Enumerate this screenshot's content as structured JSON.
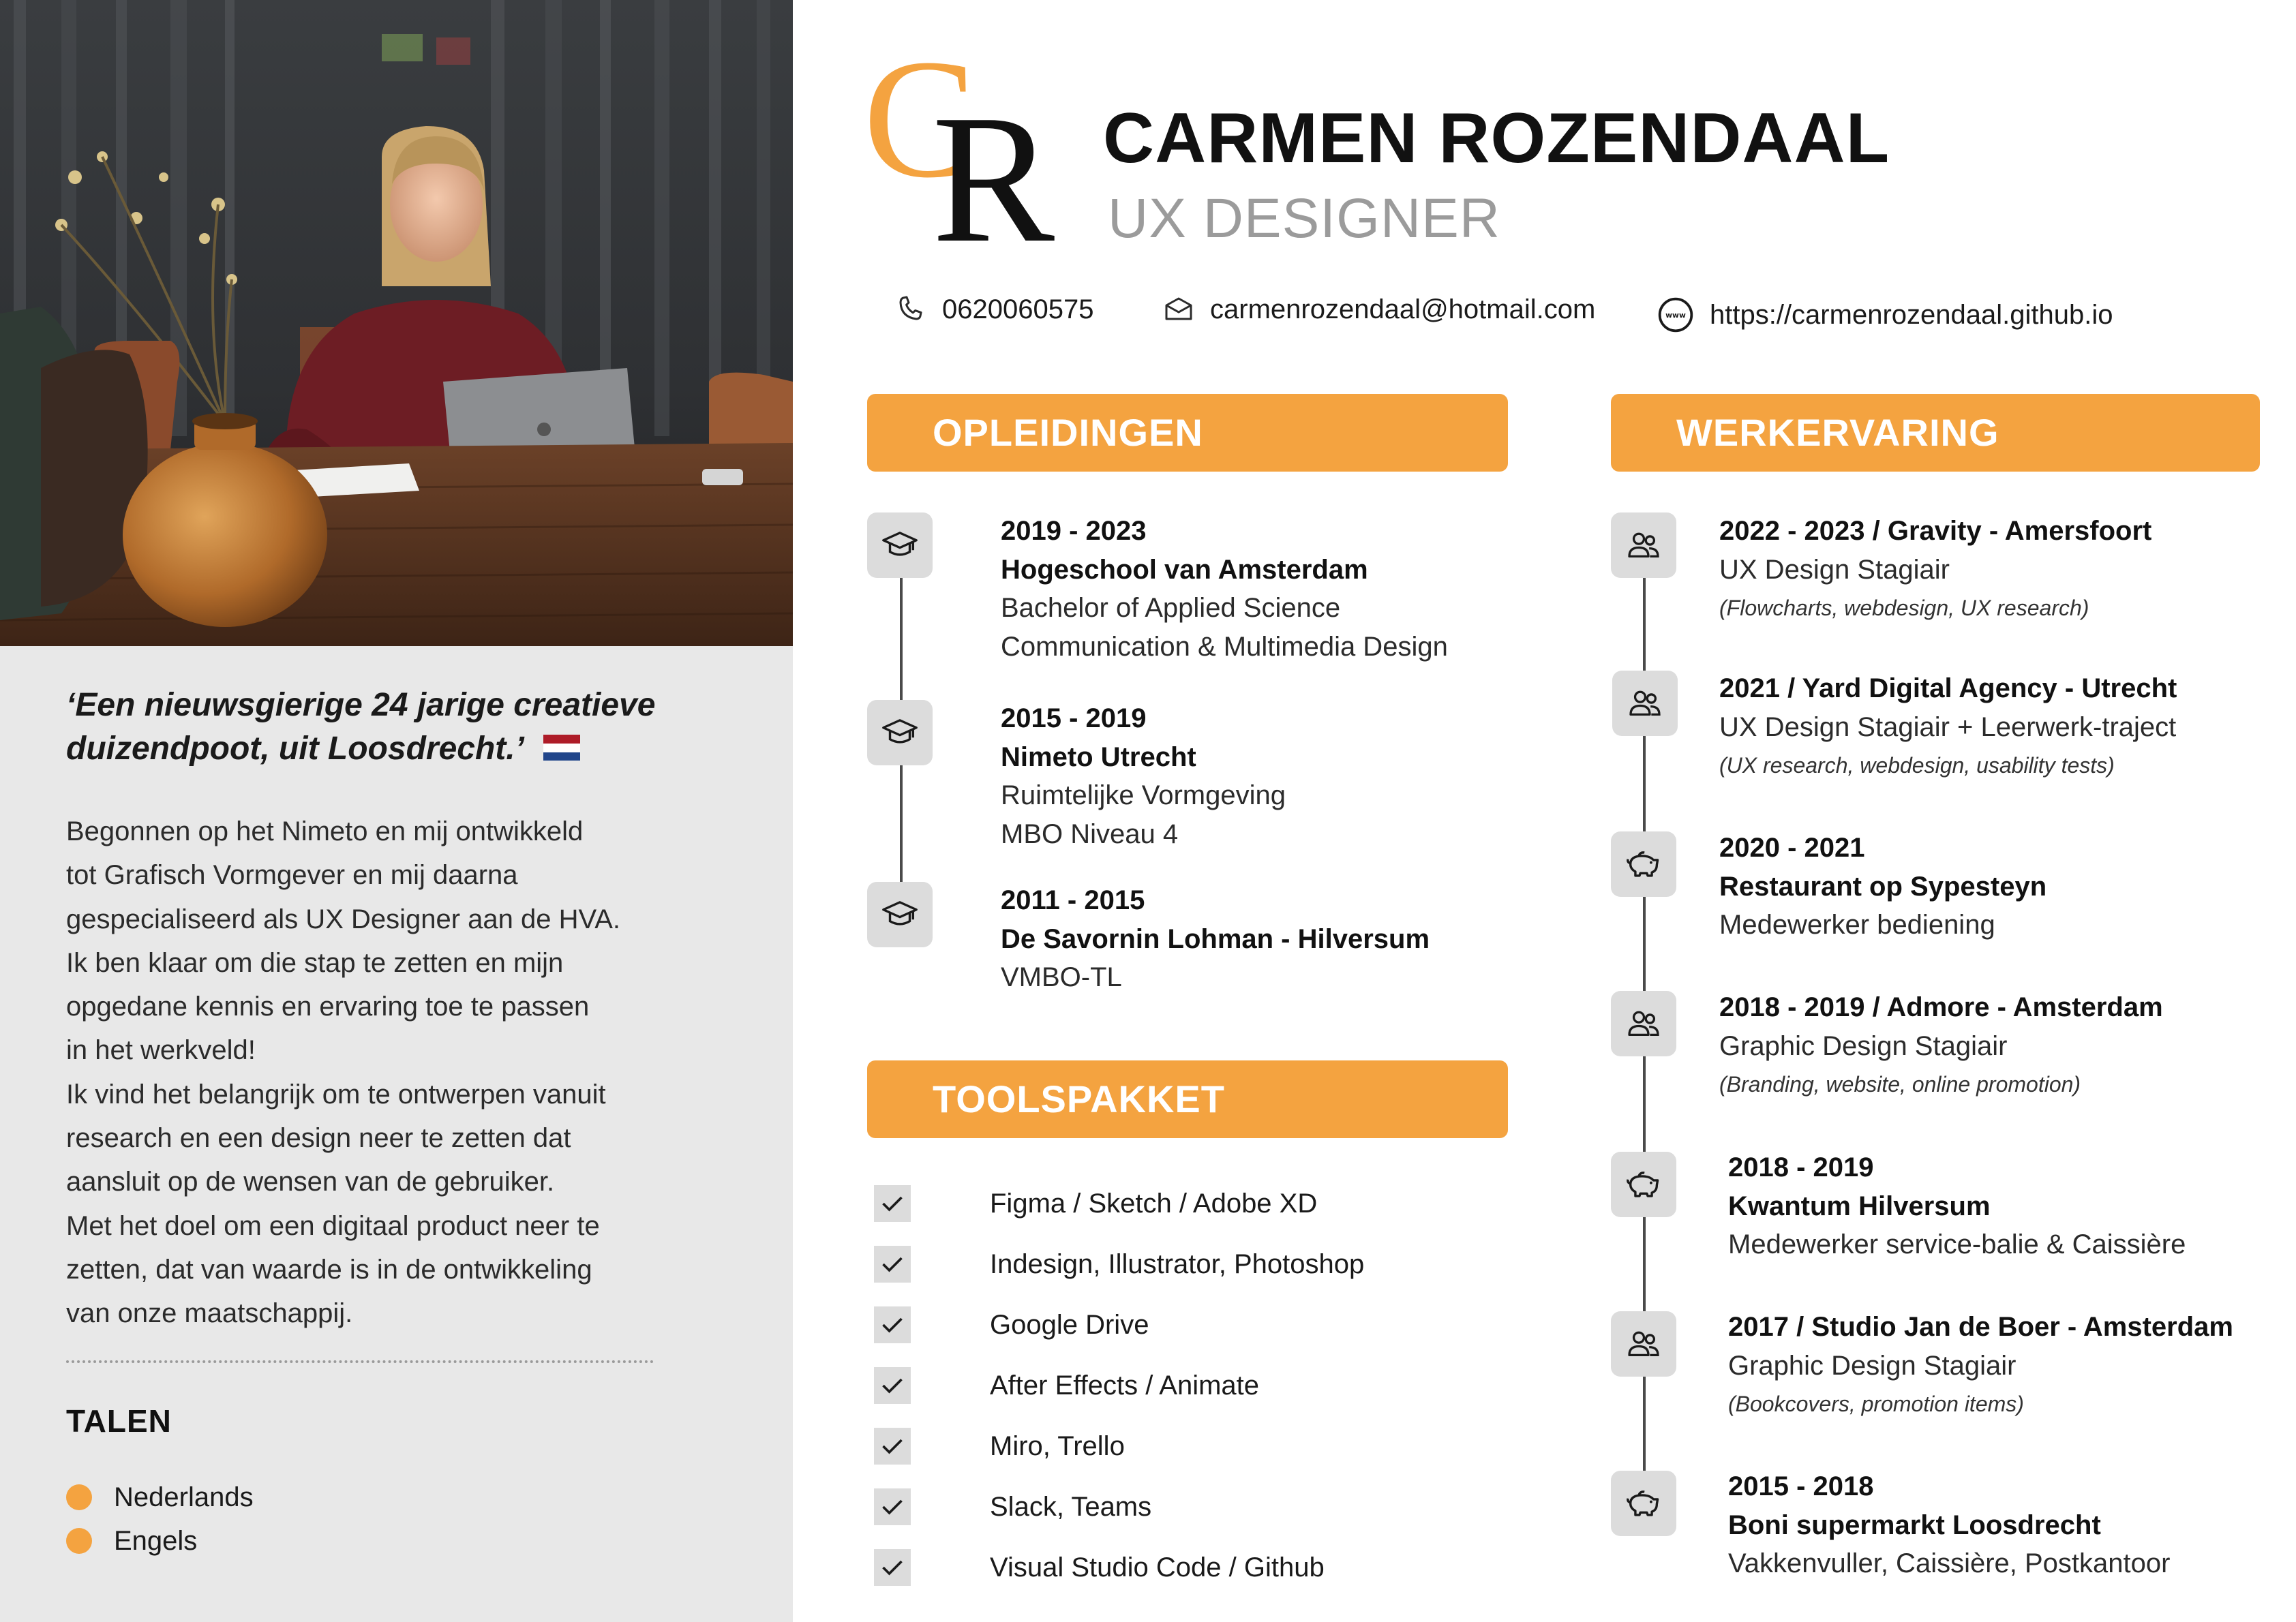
{
  "profile": {
    "name": "CARMEN ROZENDAAL",
    "role": "UX DESIGNER",
    "monogram": "CR",
    "quote_line1": "‘Een nieuwsgierige 24 jarige creatieve",
    "quote_line2": "duizendpoot, uit Loosdrecht.’",
    "bio_lines": [
      "Begonnen op het Nimeto en mij ontwikkeld",
      "tot Grafisch Vormgever en mij daarna",
      "gespecialiseerd als UX Designer aan de HVA.",
      "Ik ben klaar om die stap te zetten en mijn",
      "opgedane kennis en ervaring toe te passen",
      "in het werkveld!",
      "Ik vind het belangrijk om te ontwerpen vanuit",
      "research en een design neer te zetten dat",
      "aansluit op de wensen van de gebruiker.",
      "Met het doel om een digitaal product neer te",
      "zetten, dat van waarde is in de ontwikkeling",
      "van onze maatschappij."
    ]
  },
  "contact": {
    "phone": "0620060575",
    "email": "carmenrozendaal@hotmail.com",
    "website": "https://carmenrozendaal.github.io"
  },
  "languages": {
    "title": "TALEN",
    "items": [
      "Nederlands",
      "Engels"
    ]
  },
  "education": {
    "title": "OPLEIDINGEN",
    "items": [
      {
        "years": "2019 - 2023",
        "school": "Hogeschool van Amsterdam",
        "line1": "Bachelor of Applied Science",
        "line2": "Communication & Multimedia Design"
      },
      {
        "years": "2015 - 2019",
        "school": "Nimeto Utrecht",
        "line1": "Ruimtelijke Vormgeving",
        "line2": "MBO Niveau 4"
      },
      {
        "years": "2011 - 2015",
        "school": "De Savornin Lohman - Hilversum",
        "line1": "VMBO-TL",
        "line2": ""
      }
    ]
  },
  "tools": {
    "title": "TOOLSPAKKET",
    "items": [
      "Figma / Sketch / Adobe XD",
      "Indesign, Illustrator, Photoshop",
      "Google Drive",
      "After Effects / Animate",
      "Miro, Trello",
      "Slack, Teams",
      "Visual Studio Code / Github"
    ]
  },
  "experience": {
    "title": "WERKERVARING",
    "items": [
      {
        "icon": "people-icon",
        "heading": "2022 - 2023 / Gravity - Amersfoort",
        "role": "UX Design Stagiair",
        "note": "(Flowcharts, webdesign, UX research)"
      },
      {
        "icon": "people-icon",
        "heading": "2021 / Yard Digital Agency - Utrecht",
        "role": "UX Design Stagiair + Leerwerk-traject",
        "note": "(UX research, webdesign, usability tests)"
      },
      {
        "icon": "piggy-bank-icon",
        "heading": "2020 - 2021",
        "company": "Restaurant op Sypesteyn",
        "role": "Medewerker bediening"
      },
      {
        "icon": "people-icon",
        "heading": "2018 - 2019 / Admore - Amsterdam",
        "role": "Graphic Design Stagiair",
        "note": "(Branding, website, online promotion)"
      },
      {
        "icon": "piggy-bank-icon",
        "heading": "2018 - 2019",
        "company": "Kwantum Hilversum",
        "role": "Medewerker service-balie & Caissière"
      },
      {
        "icon": "people-icon",
        "heading": "2017 / Studio Jan de Boer - Amsterdam",
        "role": "Graphic Design Stagiair",
        "note": "(Bookcovers, promotion items)"
      },
      {
        "icon": "piggy-bank-icon",
        "heading": "2015  - 2018",
        "company": "Boni supermarkt Loosdrecht",
        "role": "Vakkenvuller, Caissière, Postkantoor"
      }
    ]
  },
  "colors": {
    "accent": "#f4a340",
    "sidebar": "#e8e8e8",
    "icon_bg": "#dcdcdc",
    "role_gray": "#9b9b9b"
  }
}
